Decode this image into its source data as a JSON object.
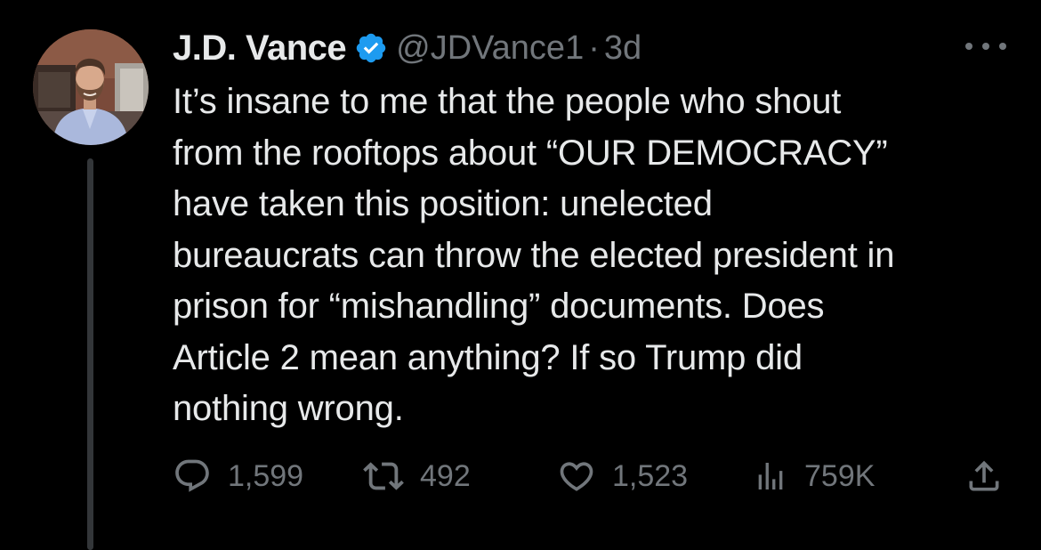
{
  "author": {
    "display_name": "J.D. Vance",
    "handle": "@JDVance1",
    "separator": "·",
    "timestamp": "3d",
    "verified": true,
    "avatar": "profile-photo"
  },
  "tweet": {
    "text": "It’s insane to me that the people who shout\nfrom the rooftops about “OUR DEMOCRACY”\nhave taken this position: unelected\nbureaucrats can throw the elected president in\nprison for “mishandling” documents. Does\nArticle 2 mean anything? If so Trump did\nnothing wrong."
  },
  "actions": {
    "replies": "1,599",
    "retweets": "492",
    "likes": "1,523",
    "views": "759K"
  },
  "icons": {
    "verified": "verified-badge-icon",
    "more": "more-options-icon",
    "reply": "reply-icon",
    "retweet": "retweet-icon",
    "like": "heart-icon",
    "views": "views-icon",
    "share": "share-icon"
  },
  "colors": {
    "background": "#000000",
    "text_primary": "#e7e9ea",
    "text_secondary": "#71767b",
    "verified_badge": "#1d9bf0",
    "thread_line": "#333639"
  }
}
